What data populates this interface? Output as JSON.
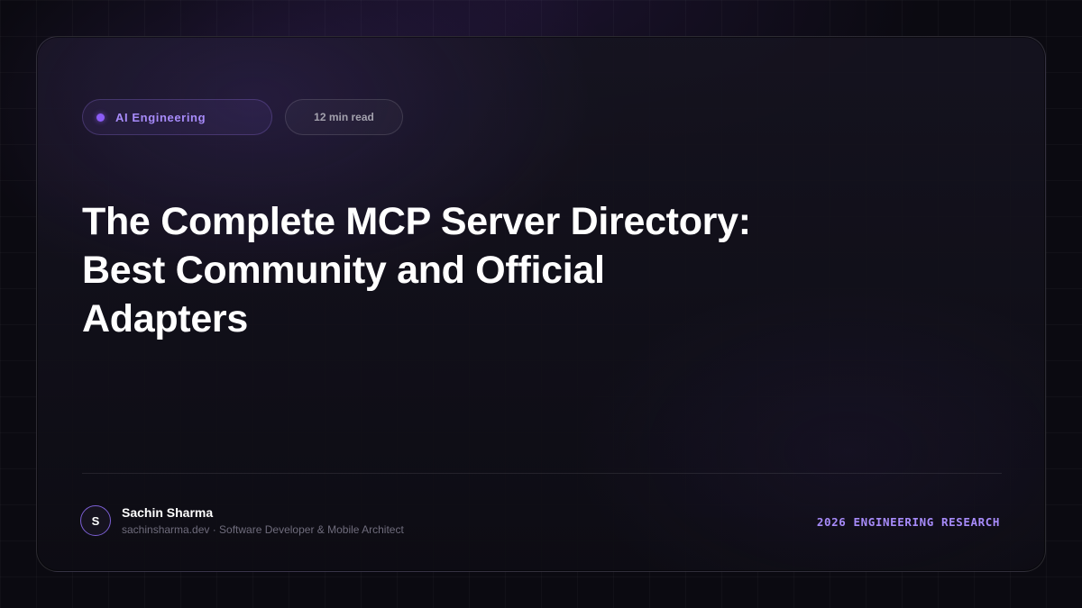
{
  "tags": {
    "topic": "AI Engineering",
    "read_time": "12 min read"
  },
  "title": {
    "line1": "The Complete MCP Server Directory:",
    "line2": "Best Community and Official",
    "line3": "Adapters"
  },
  "author": {
    "initial": "S",
    "name": "Sachin Sharma",
    "subtitle": "sachinsharma.dev · Software Developer & Mobile Architect"
  },
  "series_label": "2026 ENGINEERING RESEARCH",
  "colors": {
    "accent": "#a78bfa",
    "dot": "#8b5cf6",
    "background": "#0b0a11"
  }
}
